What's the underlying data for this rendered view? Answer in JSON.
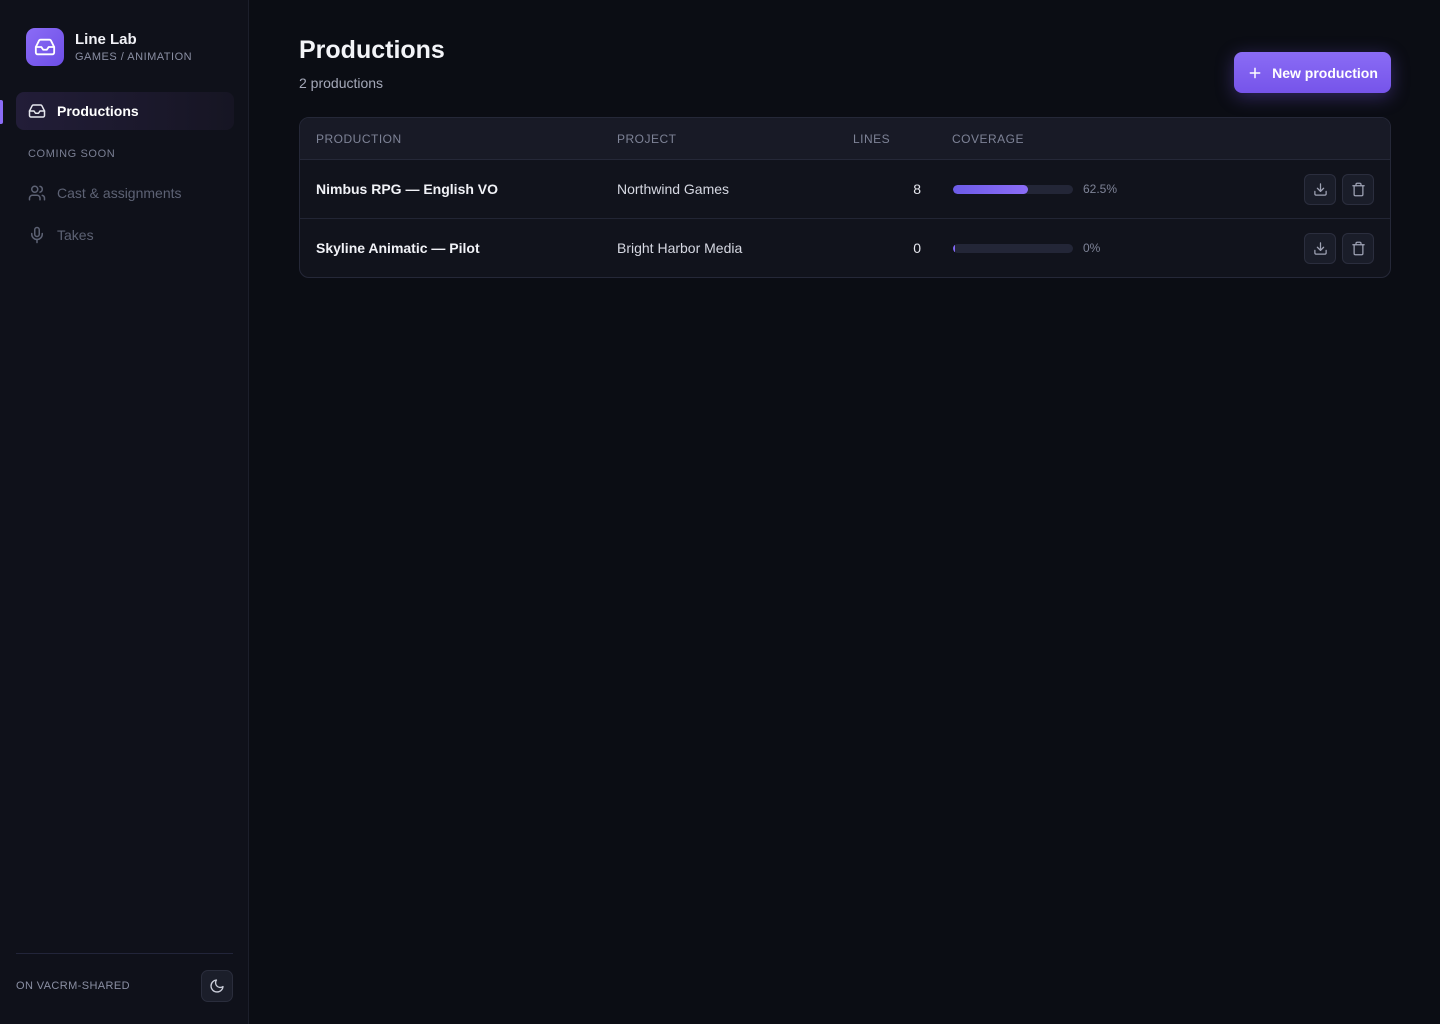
{
  "brand": {
    "name": "Line Lab",
    "subtitle": "GAMES / ANIMATION"
  },
  "sidebar": {
    "active_item": {
      "label": "Productions",
      "icon": "inbox-icon"
    },
    "section_label": "COMING SOON",
    "items": [
      {
        "label": "Cast & assignments",
        "icon": "users-icon"
      },
      {
        "label": "Takes",
        "icon": "microphone-icon"
      }
    ],
    "footer_label": "ON VACRM-SHARED",
    "theme_toggle_icon": "moon-icon"
  },
  "header": {
    "title": "Productions",
    "count_text": "2 productions",
    "new_button_label": "New production"
  },
  "table": {
    "columns": {
      "production": "PRODUCTION",
      "project": "PROJECT",
      "lines": "LINES",
      "coverage": "COVERAGE"
    },
    "rows": [
      {
        "production": "Nimbus RPG — English VO",
        "project": "Northwind Games",
        "lines": "8",
        "coverage_label": "62.5%",
        "coverage": 0.625
      },
      {
        "production": "Skyline Animatic — Pilot",
        "project": "Bright Harbor Media",
        "lines": "0",
        "coverage_label": "0%",
        "coverage": 0
      }
    ],
    "row_actions": [
      "download-icon",
      "trash-icon"
    ]
  },
  "colors": {
    "accent": "#8b6cf6",
    "background": "#0b0d14",
    "sidebar": "#0f111a"
  }
}
